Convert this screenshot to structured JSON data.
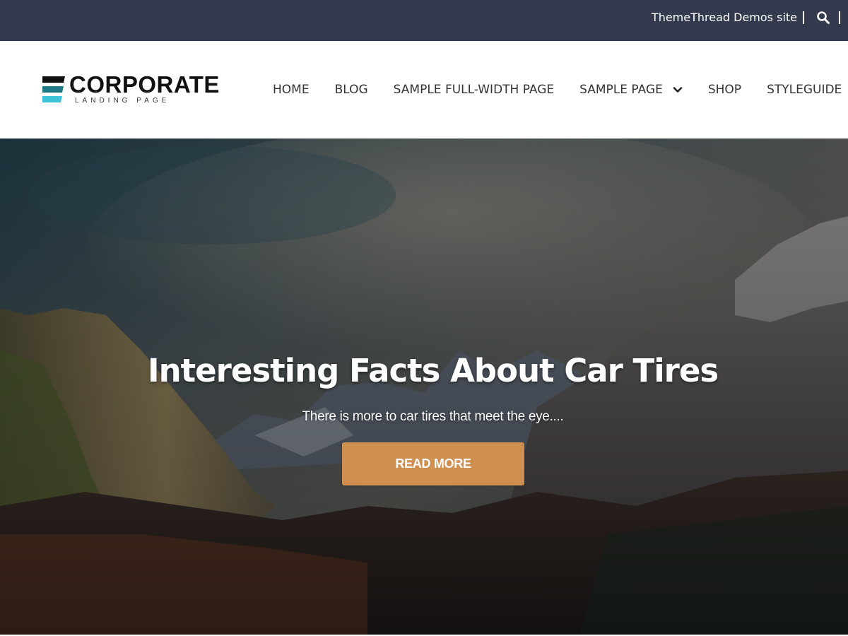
{
  "topbar": {
    "site_link": "ThemeThread Demos site",
    "search_icon": "search-icon"
  },
  "header": {
    "logo": {
      "title": "CORPORATE",
      "subtitle": "LANDING PAGE",
      "mark_colors": [
        "#111111",
        "#1f7a86",
        "#3fc3d8"
      ]
    },
    "nav": [
      {
        "label": "HOME"
      },
      {
        "label": "BLOG"
      },
      {
        "label": "SAMPLE FULL-WIDTH PAGE"
      },
      {
        "label": "SAMPLE PAGE",
        "icon": "chevron-down-icon"
      },
      {
        "label": "SHOP"
      },
      {
        "label": "STYLEGUIDE"
      }
    ]
  },
  "hero": {
    "title": "Interesting Facts About Car Tires",
    "subtitle": "There is more to car tires that meet the eye....",
    "button_label": "READ MORE",
    "button_color": "#cf8f50"
  },
  "colors": {
    "topbar_bg": "#343a4d",
    "header_bg": "#ffffff",
    "nav_text": "#333333"
  }
}
